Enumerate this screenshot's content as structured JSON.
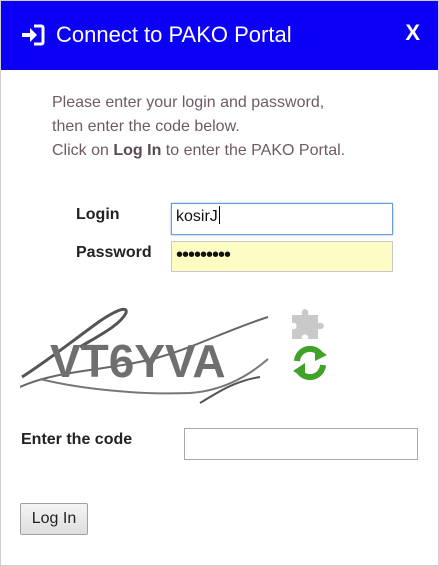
{
  "dialog": {
    "title": "Connect to PAKO Portal",
    "close_label": "X"
  },
  "instructions": {
    "line1": "Please enter your login and password,",
    "line2": "then enter the code below.",
    "line3_pre": "Click on ",
    "line3_bold": "Log In",
    "line3_post": " to enter the PAKO Portal."
  },
  "form": {
    "login_label": "Login",
    "login_value": "kosirJ",
    "password_label": "Password",
    "password_mask": "•••••••••",
    "code_label": "Enter the code",
    "code_value": ""
  },
  "captcha": {
    "text": "VT6YVA"
  },
  "buttons": {
    "login": "Log In"
  },
  "colors": {
    "titlebar": "#0b00f5",
    "instructions_text": "#6e5a67",
    "password_bg": "#fcfcc4",
    "refresh_green": "#3fa32a"
  },
  "icons": {
    "title": "login-arrow-icon",
    "puzzle": "puzzle-icon",
    "refresh": "refresh-icon"
  }
}
